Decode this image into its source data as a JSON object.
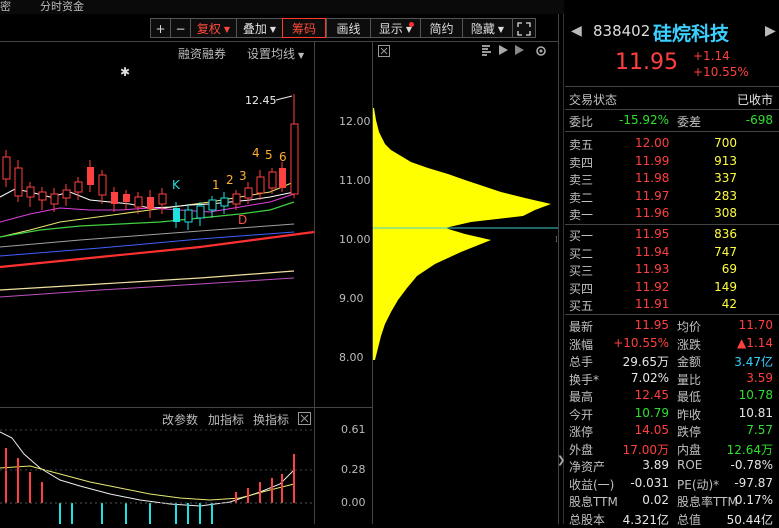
{
  "tabs": {
    "left_partial": "密",
    "fund_flow": "分时资金"
  },
  "toolbar": {
    "plus": "+",
    "minus": "−",
    "restore_rights": "复权",
    "overlay": "叠加",
    "chips": "筹码",
    "drawing": "画线",
    "display": "显示",
    "simple": "简约",
    "hide": "隐藏"
  },
  "chart_controls": {
    "margin_trading": "融资融券",
    "set_ma": "设置均线"
  },
  "kline_annotations": {
    "high_label": "12.45",
    "star": "✱",
    "k_mark": "K",
    "d_mark": "D",
    "seq": [
      "1",
      "2",
      "3",
      "4",
      "5",
      "6"
    ]
  },
  "price_axis": {
    "ticks": [
      "12.00",
      "11.00",
      "10.00",
      "9.00",
      "8.00"
    ]
  },
  "indicator": {
    "change_params": "改参数",
    "add_indicator": "加指标",
    "switch_indicator": "换指标",
    "axis_ticks": [
      "0.61",
      "0.28",
      "0.00"
    ]
  },
  "chip_distribution": {
    "type": "area",
    "x_axis": "price",
    "ylim": [
      7.8,
      12.3
    ],
    "y": [
      8.0,
      8.2,
      8.4,
      8.6,
      8.8,
      9.0,
      9.2,
      9.4,
      9.6,
      9.8,
      10.0,
      10.1,
      10.2,
      10.3,
      10.4,
      10.5,
      10.6,
      10.7,
      10.8,
      10.9,
      11.0,
      11.1,
      11.2,
      11.3,
      11.4,
      11.5,
      11.6,
      11.8,
      12.0,
      12.2
    ],
    "values": [
      2,
      5,
      8,
      12,
      18,
      25,
      34,
      44,
      62,
      88,
      118,
      92,
      72,
      98,
      150,
      162,
      178,
      152,
      128,
      110,
      92,
      75,
      55,
      38,
      28,
      18,
      12,
      6,
      3,
      1
    ],
    "current_price": 10.2
  },
  "stock": {
    "code": "838402",
    "name": "硅烷科技",
    "price": "11.95",
    "change": "+1.14",
    "change_pct": "+10.55%"
  },
  "status": {
    "label": "交易状态",
    "value": "已收市"
  },
  "ratio": {
    "wb_label": "委比",
    "wb_value": "-15.92%",
    "wc_label": "委差",
    "wc_value": "-698"
  },
  "asks": [
    {
      "label": "卖五",
      "price": "12.00",
      "vol": "700"
    },
    {
      "label": "卖四",
      "price": "11.99",
      "vol": "913"
    },
    {
      "label": "卖三",
      "price": "11.98",
      "vol": "337"
    },
    {
      "label": "卖二",
      "price": "11.97",
      "vol": "283"
    },
    {
      "label": "卖一",
      "price": "11.96",
      "vol": "308"
    }
  ],
  "bids": [
    {
      "label": "买一",
      "price": "11.95",
      "vol": "836"
    },
    {
      "label": "买二",
      "price": "11.94",
      "vol": "747"
    },
    {
      "label": "买三",
      "price": "11.93",
      "vol": "69"
    },
    {
      "label": "买四",
      "price": "11.92",
      "vol": "149"
    },
    {
      "label": "买五",
      "price": "11.91",
      "vol": "42"
    }
  ],
  "quote": [
    {
      "l1": "最新",
      "v1": "11.95",
      "c1": "red",
      "l2": "均价",
      "v2": "11.70",
      "c2": "red"
    },
    {
      "l1": "涨幅",
      "v1": "+10.55%",
      "c1": "red",
      "l2": "涨跌",
      "v2": "▲1.14",
      "c2": "red"
    },
    {
      "l1": "总手",
      "v1": "29.65万",
      "c1": "white",
      "l2": "金额",
      "v2": "3.47亿",
      "c2": "cyan"
    },
    {
      "l1": "换手*",
      "v1": "7.02%",
      "c1": "white",
      "l2": "量比",
      "v2": "3.59",
      "c2": "red"
    },
    {
      "l1": "最高",
      "v1": "12.45",
      "c1": "red",
      "l2": "最低",
      "v2": "10.78",
      "c2": "green"
    },
    {
      "l1": "今开",
      "v1": "10.79",
      "c1": "green",
      "l2": "昨收",
      "v2": "10.81",
      "c2": "white"
    },
    {
      "l1": "涨停",
      "v1": "14.05",
      "c1": "red",
      "l2": "跌停",
      "v2": "7.57",
      "c2": "green"
    },
    {
      "l1": "外盘",
      "v1": "17.00万",
      "c1": "red",
      "l2": "内盘",
      "v2": "12.64万",
      "c2": "green"
    },
    {
      "l1": "净资产",
      "v1": "3.89",
      "c1": "white",
      "l2": "ROE",
      "v2": "-0.78%",
      "c2": "white"
    },
    {
      "l1": "收益(一)",
      "v1": "-0.031",
      "c1": "white",
      "l2": "PE(动)*",
      "v2": "-97.87",
      "c2": "white"
    },
    {
      "l1": "股息TTM",
      "v1": "0.02",
      "c1": "white",
      "l2": "股息率TTM",
      "v2": "0.17%",
      "c2": "white"
    },
    {
      "l1": "总股本",
      "v1": "4.321亿",
      "c1": "white",
      "l2": "总值",
      "v2": "50.44亿",
      "c2": "white"
    }
  ],
  "colors": {
    "up": "#ff4040",
    "down": "#2ee02e",
    "chip": "#ffff00",
    "accent": "#ff3a2a",
    "cyan": "#3ad0ff"
  }
}
